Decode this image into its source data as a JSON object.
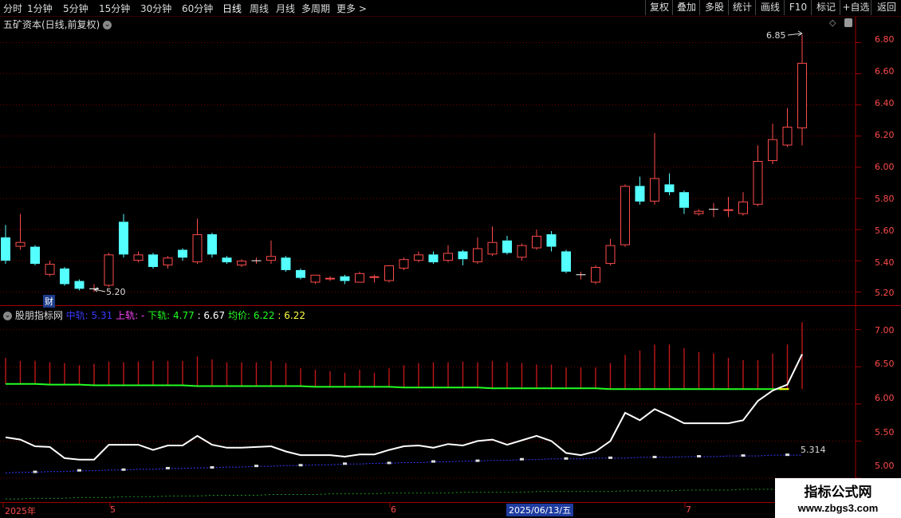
{
  "toolbar": {
    "periods": [
      "分时",
      "1分钟",
      "5分钟",
      "15分钟",
      "30分钟",
      "60分钟",
      "日线",
      "周线",
      "月线",
      "多周期",
      "更多 >"
    ],
    "active_period": "日线",
    "right_buttons": [
      "复权",
      "叠加",
      "多股",
      "统计",
      "画线",
      "F10",
      "标记",
      "+自选",
      "返回"
    ]
  },
  "main_panel": {
    "title": "五矿资本(日线,前复权)",
    "y_ticks": [
      "6.80",
      "6.60",
      "6.40",
      "6.20",
      "6.00",
      "5.80",
      "5.60",
      "5.40",
      "5.20"
    ],
    "high_label": "6.85",
    "low_label": "5.20",
    "marker": "财"
  },
  "indicator": {
    "name": "股朋指标网",
    "mid_label": "中轨:",
    "mid_value": "5.31",
    "up_label": "上轨:",
    "up_value": "-",
    "down_label": "下轨:",
    "down_value": "4.77",
    "extra_value": ": 6.67",
    "avg_label": "均价:",
    "avg_value": "6.22",
    "avg_extra": ": 6.22",
    "y_ticks": [
      "7.00",
      "6.50",
      "6.00",
      "5.50",
      "5.00"
    ],
    "end_label": "5.314"
  },
  "date_axis": {
    "labels": [
      "2025年",
      "5",
      "6",
      "2025/06/13/五",
      "7"
    ]
  },
  "watermark": {
    "line1": "指标公式网",
    "line2": "www.zbgs3.com"
  },
  "colors": {
    "up": "#ff4b4b",
    "down": "#54ffff",
    "grid": "#7a0000",
    "green": "#22ff22",
    "white": "#ffffff",
    "blue": "#3a3aff",
    "yellow": "#ffff00",
    "magenta": "#ff44ff"
  },
  "chart_data": {
    "type": "candlestick",
    "candles": [
      [
        5.55,
        5.4,
        5.63,
        5.38
      ],
      [
        5.49,
        5.52,
        5.7,
        5.47
      ],
      [
        5.49,
        5.38,
        5.5,
        5.37
      ],
      [
        5.31,
        5.38,
        5.4,
        5.3
      ],
      [
        5.35,
        5.25,
        5.36,
        5.24
      ],
      [
        5.27,
        5.22,
        5.28,
        5.21
      ],
      [
        5.22,
        5.22,
        5.25,
        5.2
      ],
      [
        5.24,
        5.44,
        5.45,
        5.23
      ],
      [
        5.65,
        5.44,
        5.7,
        5.42
      ],
      [
        5.4,
        5.44,
        5.46,
        5.39
      ],
      [
        5.44,
        5.36,
        5.45,
        5.35
      ],
      [
        5.37,
        5.42,
        5.43,
        5.35
      ],
      [
        5.47,
        5.42,
        5.48,
        5.4
      ],
      [
        5.39,
        5.57,
        5.67,
        5.38
      ],
      [
        5.57,
        5.44,
        5.58,
        5.42
      ],
      [
        5.42,
        5.39,
        5.43,
        5.38
      ],
      [
        5.37,
        5.4,
        5.41,
        5.36
      ],
      [
        5.4,
        5.4,
        5.42,
        5.38
      ],
      [
        5.4,
        5.43,
        5.53,
        5.38
      ],
      [
        5.42,
        5.34,
        5.43,
        5.33
      ],
      [
        5.34,
        5.29,
        5.35,
        5.28
      ],
      [
        5.26,
        5.31,
        5.31,
        5.25
      ],
      [
        5.28,
        5.29,
        5.3,
        5.27
      ],
      [
        5.3,
        5.27,
        5.31,
        5.25
      ],
      [
        5.26,
        5.32,
        5.33,
        5.26
      ],
      [
        5.29,
        5.3,
        5.31,
        5.26
      ],
      [
        5.27,
        5.37,
        5.37,
        5.26
      ],
      [
        5.35,
        5.41,
        5.42,
        5.34
      ],
      [
        5.4,
        5.44,
        5.46,
        5.39
      ],
      [
        5.44,
        5.39,
        5.46,
        5.38
      ],
      [
        5.4,
        5.45,
        5.5,
        5.39
      ],
      [
        5.46,
        5.41,
        5.47,
        5.37
      ],
      [
        5.39,
        5.48,
        5.55,
        5.38
      ],
      [
        5.44,
        5.52,
        5.62,
        5.43
      ],
      [
        5.53,
        5.45,
        5.56,
        5.44
      ],
      [
        5.42,
        5.5,
        5.51,
        5.4
      ],
      [
        5.48,
        5.56,
        5.6,
        5.47
      ],
      [
        5.57,
        5.49,
        5.59,
        5.46
      ],
      [
        5.46,
        5.33,
        5.47,
        5.32
      ],
      [
        5.31,
        5.31,
        5.33,
        5.28
      ],
      [
        5.26,
        5.36,
        5.37,
        5.25
      ],
      [
        5.38,
        5.5,
        5.54,
        5.37
      ],
      [
        5.5,
        5.88,
        5.89,
        5.49
      ],
      [
        5.88,
        5.78,
        5.94,
        5.76
      ],
      [
        5.78,
        5.93,
        6.22,
        5.76
      ],
      [
        5.89,
        5.84,
        5.96,
        5.82
      ],
      [
        5.84,
        5.74,
        5.85,
        5.7
      ],
      [
        5.7,
        5.72,
        5.73,
        5.69
      ],
      [
        5.73,
        5.73,
        5.77,
        5.68
      ],
      [
        5.72,
        5.73,
        5.81,
        5.68
      ],
      [
        5.7,
        5.78,
        5.84,
        5.69
      ],
      [
        5.76,
        6.04,
        6.14,
        5.75
      ],
      [
        6.04,
        6.18,
        6.28,
        6.02
      ],
      [
        6.14,
        6.26,
        6.38,
        6.13
      ],
      [
        6.25,
        6.67,
        6.85,
        6.14
      ]
    ],
    "y_range": [
      5.14,
      6.92
    ],
    "indicator_series": {
      "white": [
        5.55,
        5.52,
        5.43,
        5.42,
        5.27,
        5.25,
        5.25,
        5.45,
        5.45,
        5.45,
        5.38,
        5.44,
        5.44,
        5.57,
        5.45,
        5.41,
        5.41,
        5.42,
        5.43,
        5.36,
        5.31,
        5.31,
        5.31,
        5.29,
        5.32,
        5.32,
        5.38,
        5.43,
        5.44,
        5.41,
        5.46,
        5.44,
        5.5,
        5.52,
        5.45,
        5.51,
        5.57,
        5.5,
        5.34,
        5.31,
        5.36,
        5.5,
        5.88,
        5.78,
        5.93,
        5.84,
        5.74,
        5.74,
        5.74,
        5.74,
        5.78,
        6.04,
        6.18,
        6.26,
        6.67
      ],
      "green": [
        6.27,
        6.27,
        6.27,
        6.26,
        6.26,
        6.26,
        6.25,
        6.25,
        6.25,
        6.25,
        6.25,
        6.25,
        6.25,
        6.24,
        6.24,
        6.24,
        6.24,
        6.24,
        6.24,
        6.24,
        6.24,
        6.23,
        6.23,
        6.23,
        6.23,
        6.23,
        6.23,
        6.22,
        6.22,
        6.22,
        6.22,
        6.22,
        6.22,
        6.21,
        6.21,
        6.21,
        6.21,
        6.21,
        6.21,
        6.21,
        6.21,
        6.2,
        6.2,
        6.2,
        6.2,
        6.2,
        6.2,
        6.2,
        6.2,
        6.2,
        6.2,
        6.2,
        6.2,
        6.2
      ],
      "blue": [
        5.07,
        5.08,
        5.08,
        5.09,
        5.09,
        5.1,
        5.1,
        5.11,
        5.11,
        5.12,
        5.12,
        5.13,
        5.13,
        5.14,
        5.14,
        5.15,
        5.15,
        5.16,
        5.16,
        5.17,
        5.17,
        5.18,
        5.18,
        5.19,
        5.19,
        5.2,
        5.2,
        5.21,
        5.21,
        5.22,
        5.22,
        5.23,
        5.23,
        5.24,
        5.24,
        5.25,
        5.25,
        5.26,
        5.26,
        5.26,
        5.27,
        5.27,
        5.27,
        5.28,
        5.28,
        5.28,
        5.29,
        5.29,
        5.29,
        5.3,
        5.3,
        5.3,
        5.31,
        5.31,
        5.31
      ],
      "dgreen": [
        4.72,
        4.72,
        4.73,
        4.73,
        4.73,
        4.74,
        4.74,
        4.74,
        4.75,
        4.75,
        4.75,
        4.76,
        4.76,
        4.76,
        4.77,
        4.77,
        4.77,
        4.77,
        4.78,
        4.78,
        4.78,
        4.78,
        4.79,
        4.79,
        4.79,
        4.79,
        4.8,
        4.8,
        4.8,
        4.8,
        4.8,
        4.81,
        4.81,
        4.81,
        4.81,
        4.81,
        4.82,
        4.82,
        4.82,
        4.82,
        4.82,
        4.82,
        4.83,
        4.83,
        4.83,
        4.83,
        4.84,
        4.84,
        4.84,
        4.84,
        4.85,
        4.85,
        4.85,
        4.86,
        4.86
      ],
      "bars": [
        6.62,
        6.58,
        6.58,
        6.56,
        6.55,
        6.52,
        6.54,
        6.57,
        6.56,
        6.57,
        6.58,
        6.58,
        6.58,
        6.64,
        6.6,
        6.56,
        6.56,
        6.56,
        6.58,
        6.55,
        6.48,
        6.46,
        6.44,
        6.42,
        6.46,
        6.42,
        6.48,
        6.52,
        6.55,
        6.56,
        6.56,
        6.57,
        6.56,
        6.58,
        6.56,
        6.55,
        6.53,
        6.53,
        6.49,
        6.49,
        6.49,
        6.55,
        6.66,
        6.72,
        6.8,
        6.8,
        6.75,
        6.7,
        6.68,
        6.62,
        6.59,
        6.59,
        6.68,
        6.8,
        7.1
      ],
      "y_range": [
        4.7,
        7.2
      ]
    }
  }
}
